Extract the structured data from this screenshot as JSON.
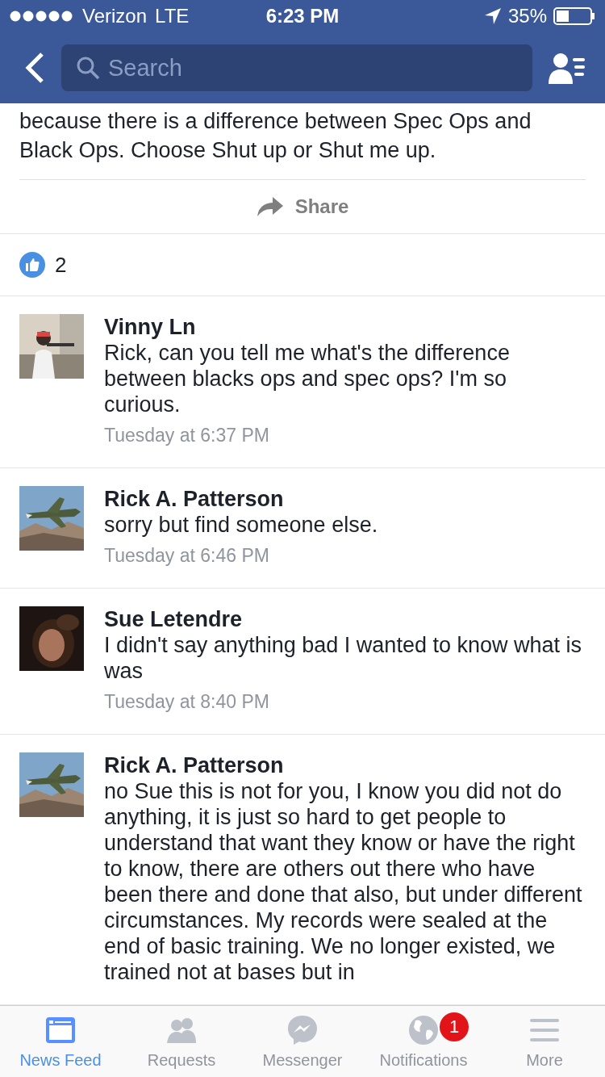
{
  "status_bar": {
    "carrier": "Verizon",
    "network": "LTE",
    "time": "6:23 PM",
    "battery": "35%"
  },
  "nav": {
    "search": {
      "placeholder": "Search"
    }
  },
  "post": {
    "text": "because there is a difference between Spec Ops and Black Ops.  Choose Shut up or Shut me up.",
    "share": "Share",
    "likes": "2"
  },
  "comments": [
    {
      "author": "Vinny Ln",
      "text": "Rick, can you tell me what's the difference between blacks ops and spec ops? I'm so curious.",
      "time": "Tuesday at 6:37 PM"
    },
    {
      "author": "Rick A. Patterson",
      "text": "sorry but find someone else.",
      "time": "Tuesday at 6:46 PM"
    },
    {
      "author": "Sue Letendre",
      "text": "I didn't say anything bad I wanted to know what is was",
      "time": "Tuesday at 8:40 PM"
    },
    {
      "author": "Rick A. Patterson",
      "text": "no Sue this is not for you,  I know you did not do anything, it is just so hard to get people to understand that want they know or have the right to know, there are others out there who have been there and done that also, but under different circumstances.  My records were sealed at the end of basic training.  We no longer existed, we trained not at bases but in"
    }
  ],
  "tab_bar": [
    {
      "kind": "news",
      "label": "News Feed",
      "selected": true
    },
    {
      "kind": "requests",
      "label": "Requests",
      "selected": false
    },
    {
      "kind": "messenger",
      "label": "Messenger",
      "selected": false
    },
    {
      "kind": "notifications",
      "label": "Notifications",
      "selected": false,
      "badge": "1"
    },
    {
      "kind": "more",
      "label": "More",
      "selected": false
    }
  ]
}
